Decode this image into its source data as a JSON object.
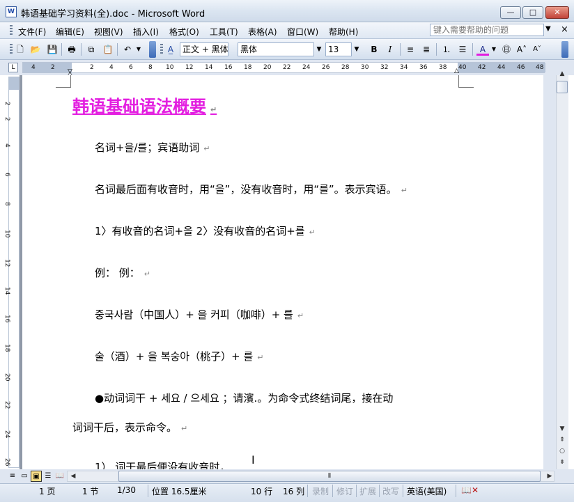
{
  "window": {
    "title": "韩语基础学习资料(全).doc - Microsoft Word",
    "minimize": "—",
    "maximize": "□",
    "close": "✕"
  },
  "menu": {
    "items": [
      "文件(F)",
      "编辑(E)",
      "视图(V)",
      "插入(I)",
      "格式(O)",
      "工具(T)",
      "表格(A)",
      "窗口(W)",
      "帮助(H)"
    ],
    "help_placeholder": "键入需要帮助的问题",
    "close_doc": "×"
  },
  "toolbar": {
    "style": "正文 + 黑体",
    "font": "黑体",
    "size": "13",
    "bold": "B",
    "italic": "I"
  },
  "ruler": {
    "numbers": [
      "4",
      "2",
      "2",
      "4",
      "6",
      "8",
      "10",
      "12",
      "14",
      "16",
      "18",
      "20",
      "22",
      "24",
      "26",
      "28",
      "30",
      "32",
      "34",
      "36",
      "38",
      "40",
      "42",
      "44",
      "46",
      "48"
    ],
    "vnumbers": [
      "2",
      "2",
      "4",
      "6",
      "8",
      "10",
      "12",
      "14",
      "16",
      "18",
      "20",
      "22",
      "24",
      "26"
    ]
  },
  "document": {
    "heading": "韩语基础语法概要",
    "paragraphs": [
      "名词+을/를；宾语助词",
      "名词最后面有收音时，用“을”，没有收音时，用“를”。表示宾语。",
      "1〉有收音的名词+을  2〉没有收音的名词+를",
      "例：  例：",
      "중국사람（中国人）+ 을  커피（咖啡）+ 를",
      "술（酒）+ 을  복숭아（桃子）+ 를",
      "●动词词干 + 세요 / 으세요 ；请濱.。为命令式终结词尾，接在动",
      "词词干后，表示命令。",
      "1）  词干最后便没有收音时，"
    ]
  },
  "status": {
    "page": "1 页",
    "section": "1 节",
    "page_of": "1/30",
    "position": "位置 16.5厘米",
    "line": "10 行",
    "column": "16 列",
    "rec": "录制",
    "trk": "修订",
    "ext": "扩展",
    "ovr": "改写",
    "lang": "英语(美国)"
  }
}
